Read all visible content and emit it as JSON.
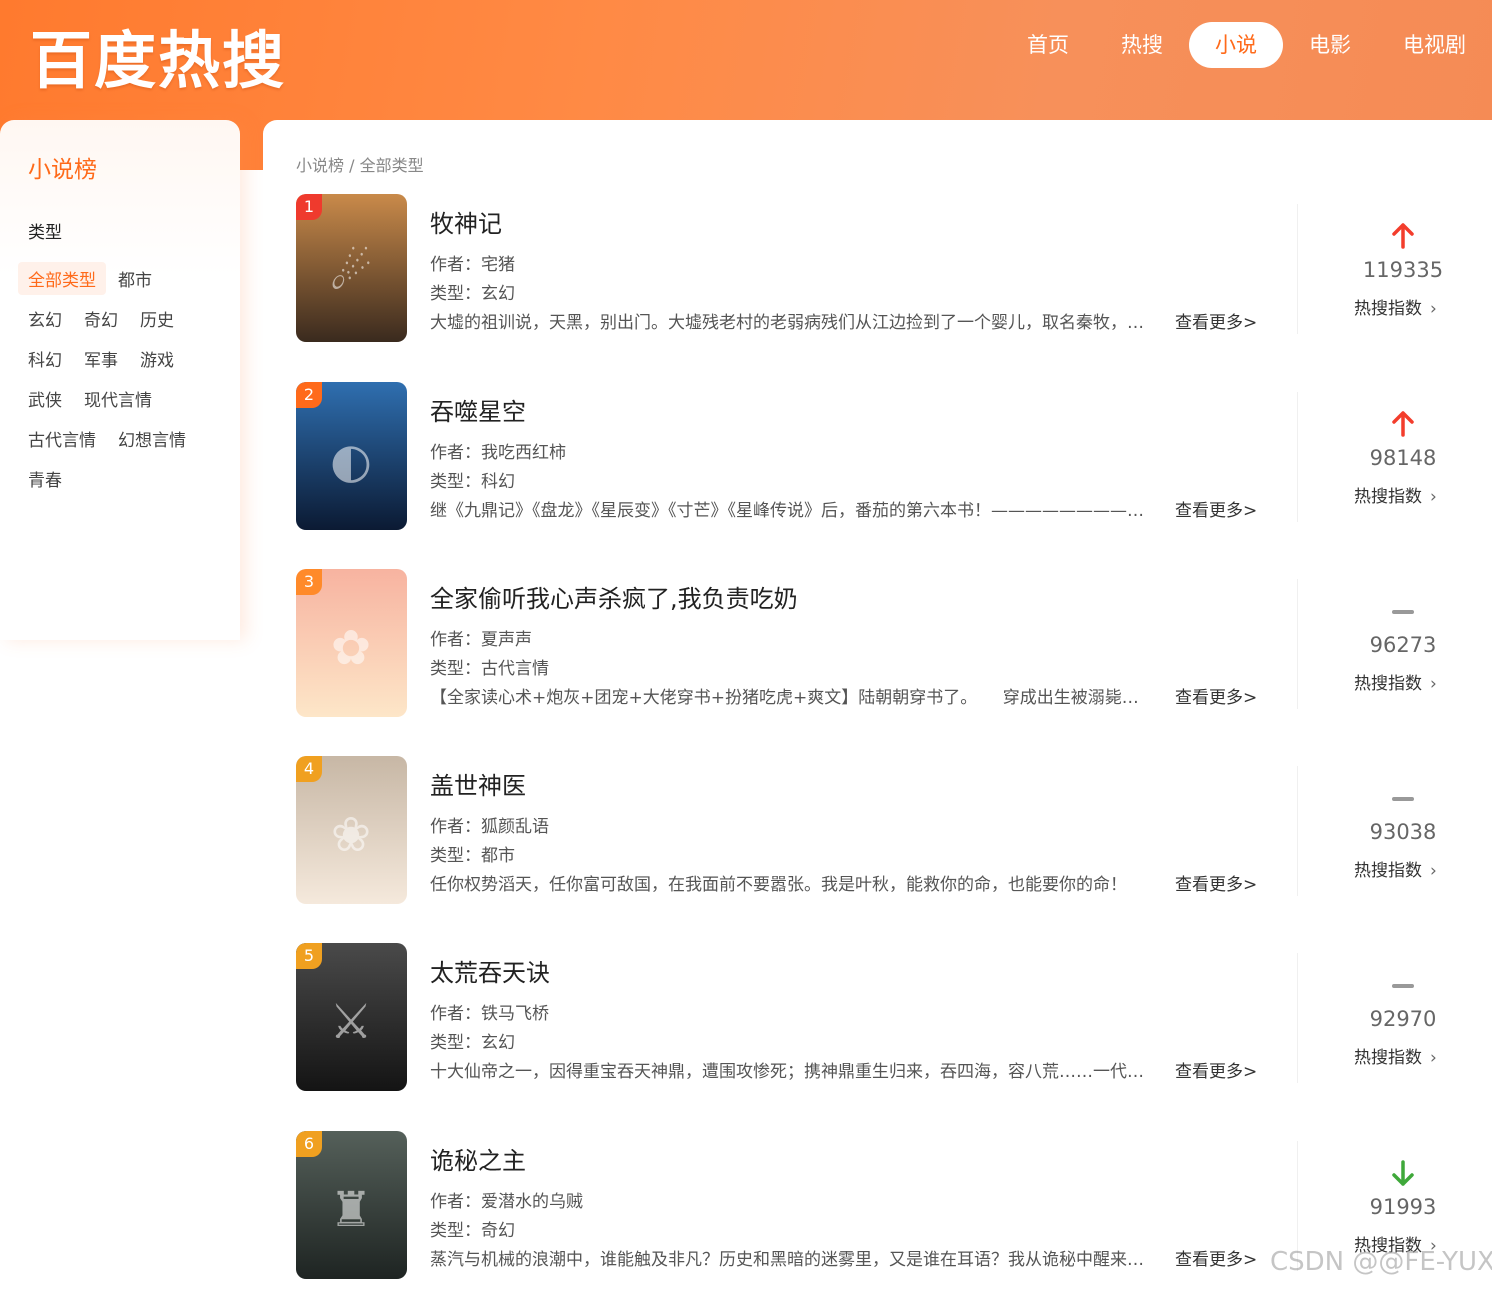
{
  "header": {
    "logo": "百度热搜",
    "nav": [
      {
        "label": "首页",
        "active": false
      },
      {
        "label": "热搜",
        "active": false
      },
      {
        "label": "小说",
        "active": true
      },
      {
        "label": "电影",
        "active": false
      },
      {
        "label": "电视剧",
        "active": false
      }
    ]
  },
  "sidebar": {
    "title": "小说榜",
    "section_label": "类型",
    "categories": [
      [
        "全部类型",
        "都市"
      ],
      [
        "玄幻",
        "奇幻",
        "历史"
      ],
      [
        "科幻",
        "军事",
        "游戏"
      ],
      [
        "武侠",
        "现代言情"
      ],
      [
        "古代言情",
        "幻想言情"
      ],
      [
        "青春"
      ]
    ],
    "active_category": "全部类型"
  },
  "main": {
    "breadcrumb": "小说榜 / 全部类型",
    "more_label": "查看更多>",
    "hot_label": "热搜指数",
    "author_prefix": "作者：",
    "type_prefix": "类型：",
    "items": [
      {
        "rank": "1",
        "title": "牧神记",
        "author": "宅猪",
        "type": "玄幻",
        "desc": "大墟的祖训说，天黑，别出门。大墟残老村的老弱病残们从江边捡到了一个婴儿，取名秦牧，含辛茹苦将他养大。",
        "score": "119335",
        "trend": "up"
      },
      {
        "rank": "2",
        "title": "吞噬星空",
        "author": "我吃西红柿",
        "type": "科幻",
        "desc": "继《九鼎记》《盘龙》《星辰变》《寸芒》《星峰传说》后，番茄的第六本书！———————————",
        "score": "98148",
        "trend": "up"
      },
      {
        "rank": "3",
        "title": "全家偷听我心声杀疯了,我负责吃奶",
        "author": "夏声声",
        "type": "古代言情",
        "desc": "【全家读心术+炮灰+团宠+大佬穿书+扮猪吃虎+爽文】陆朝朝穿书了。　　穿成出生被溺毙的陆家小女儿",
        "score": "96273",
        "trend": "flat"
      },
      {
        "rank": "4",
        "title": "盖世神医",
        "author": "狐颜乱语",
        "type": "都市",
        "desc": "任你权势滔天，任你富可敌国，在我面前不要嚣张。我是叶秋，能救你的命，也能要你的命！",
        "score": "93038",
        "trend": "flat"
      },
      {
        "rank": "5",
        "title": "太荒吞天诀",
        "author": "铁马飞桥",
        "type": "玄幻",
        "desc": "十大仙帝之一，因得重宝吞天神鼎，遭围攻惨死；携神鼎重生归来，吞四海，容八荒……一代至尊霸主归来！",
        "score": "92970",
        "trend": "flat"
      },
      {
        "rank": "6",
        "title": "诡秘之主",
        "author": "爱潜水的乌贼",
        "type": "奇幻",
        "desc": "蒸汽与机械的浪潮中，谁能触及非凡？历史和黑暗的迷雾里，又是谁在耳语？我从诡秘中醒来，睁眼看见这个世界",
        "score": "91993",
        "trend": "down"
      }
    ]
  },
  "watermark": "CSDN @@FE-YUX",
  "colors": {
    "accent": "#ff6a1a",
    "up": "#f33d2c",
    "down": "#3fa83a",
    "flat": "#999999",
    "rank_colors": [
      "#ef3a2d",
      "#ff6a1a",
      "#ff8a2a",
      "#f0a020",
      "#f0a020",
      "#f0a020"
    ]
  }
}
